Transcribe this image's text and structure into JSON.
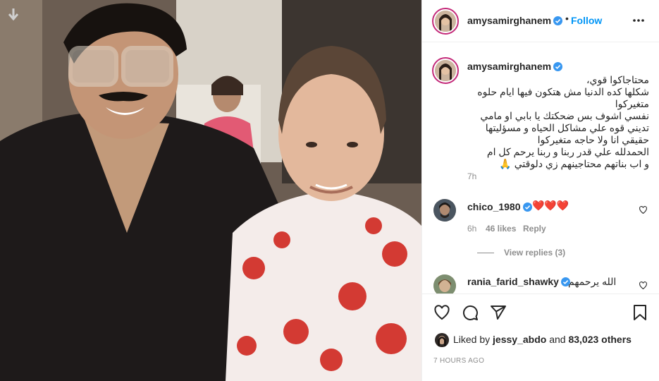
{
  "post": {
    "author": "amysamirghanem",
    "follow_label": "Follow",
    "dot": "•",
    "caption": "محتاجاكوا قوي،\nشكلها كده الدنيا مش هتكون فيها ايام حلوه\nمتغيركوا\nنفسي اشوف بس ضحكتك يا بابي او مامي\nتديني قوه علي مشاكل الحياه و مسؤليتها\nحقيقي انا ولا حاجه متغيركوا\nالحمدلله علي قدر ربنا و ربنا يرحم كل ام\nو اب بناتهم محتاجينهم زي دلوقتي 🙏",
    "caption_time": "7h"
  },
  "comments": [
    {
      "user": "chico_1980",
      "text": "❤️❤️❤️",
      "time": "6h",
      "likes": "46 likes",
      "reply": "Reply"
    },
    {
      "user": "rania_farid_shawky",
      "text": "الله يرحمهم"
    }
  ],
  "view_replies": "View replies (3)",
  "likes_row": {
    "prefix": "Liked by ",
    "user": "jessy_abdo",
    "middle": " and ",
    "others": "83,023 others"
  },
  "post_time": "7 HOURS AGO",
  "colors": {
    "accent": "#0095f6",
    "verified": "#3897f0",
    "heart": "#ed4956"
  },
  "icons": [
    "download-arrow-icon",
    "verified-icon",
    "more-options-icon",
    "heart-icon",
    "comment-icon",
    "share-icon",
    "bookmark-icon"
  ]
}
